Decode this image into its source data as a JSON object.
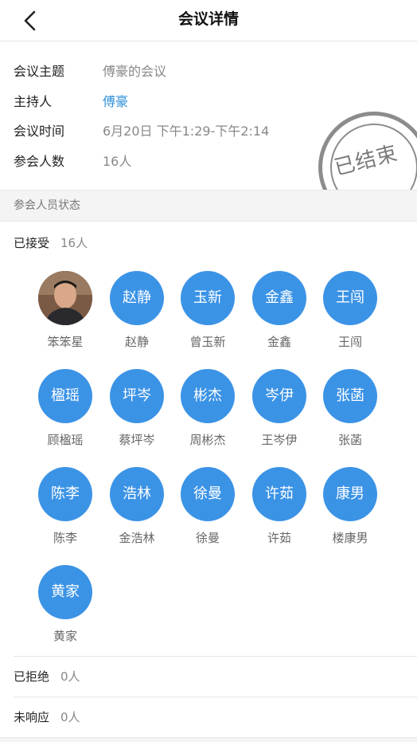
{
  "nav": {
    "title": "会议详情",
    "back_icon": "chevron-left-icon"
  },
  "info": {
    "topic": {
      "label": "会议主题",
      "value": "傅豪的会议"
    },
    "host": {
      "label": "主持人",
      "value": "傅豪"
    },
    "time": {
      "label": "会议时间",
      "value": "6月20日 下午1:29-下午2:14"
    },
    "count": {
      "label": "参会人数",
      "value": "16人"
    },
    "stamp": "已结束"
  },
  "section": {
    "title": "参会人员状态"
  },
  "accepted": {
    "label": "已接受",
    "count": "16人",
    "attendees": [
      {
        "avatar": "",
        "name": "笨笨星",
        "photo": true
      },
      {
        "avatar": "赵静",
        "name": "赵静"
      },
      {
        "avatar": "玉新",
        "name": "曾玉新"
      },
      {
        "avatar": "金鑫",
        "name": "金鑫"
      },
      {
        "avatar": "王闯",
        "name": "王闯"
      },
      {
        "avatar": "楹瑶",
        "name": "顾楹瑶"
      },
      {
        "avatar": "坪岑",
        "name": "蔡坪岑"
      },
      {
        "avatar": "彬杰",
        "name": "周彬杰"
      },
      {
        "avatar": "岑伊",
        "name": "王岑伊"
      },
      {
        "avatar": "张菡",
        "name": "张菡"
      },
      {
        "avatar": "陈李",
        "name": "陈李"
      },
      {
        "avatar": "浩林",
        "name": "金浩林"
      },
      {
        "avatar": "徐曼",
        "name": "徐曼"
      },
      {
        "avatar": "许茹",
        "name": "许茹"
      },
      {
        "avatar": "康男",
        "name": "楼康男"
      },
      {
        "avatar": "黄家",
        "name": "黄家"
      }
    ]
  },
  "rejected": {
    "label": "已拒绝",
    "count": "0人"
  },
  "no_response": {
    "label": "未响应",
    "count": "0人"
  },
  "colors": {
    "accent": "#3b93e6",
    "link": "#2e8fd9",
    "stamp": "#8c8c8c"
  }
}
